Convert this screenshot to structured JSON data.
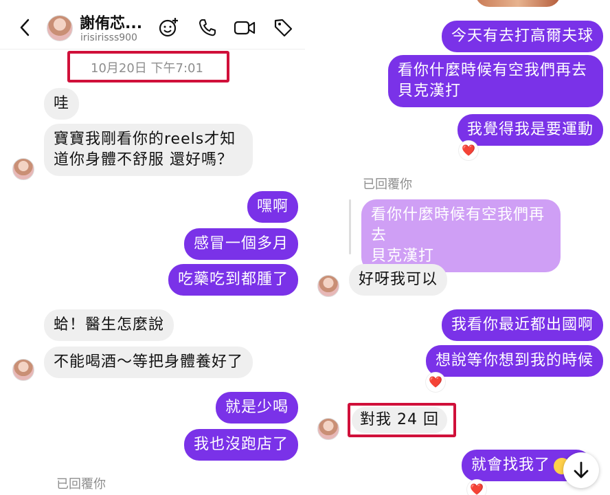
{
  "header": {
    "name": "謝侑芯...",
    "username": "irisirisss900"
  },
  "left": {
    "timestamp": "10月20日 下午7:01",
    "messages": [
      {
        "text": "哇"
      },
      {
        "text": "寶寶我剛看你的reels才知"
      },
      {
        "text": "道你身體不舒服 還好嗎？"
      },
      {
        "text": "嘿啊"
      },
      {
        "text": "感冒一個多月"
      },
      {
        "text": "吃藥吃到都腫了"
      },
      {
        "text": "蛤！醫生怎麼說"
      },
      {
        "text": "不能喝酒～等把身體養好了"
      },
      {
        "text": "就是少喝"
      },
      {
        "text": "我也沒跑店了"
      }
    ],
    "replied_label": "已回覆你"
  },
  "right": {
    "messages": [
      {
        "text": "今天有去打高爾夫球"
      },
      {
        "text": "看你什麼時候有空我們再去"
      },
      {
        "text": "貝克漢打"
      },
      {
        "text": "我覺得我是要運動"
      },
      {
        "text": "好呀我可以"
      },
      {
        "text": "我看你最近都出國啊"
      },
      {
        "text": "想說等你想到我的時候"
      },
      {
        "text": "對我 24 回"
      },
      {
        "text": "就會找我了"
      }
    ],
    "replied_label": "已回覆你",
    "quoted": {
      "line1": "看你什麼時候有空我們再去",
      "line2": "貝克漢打"
    },
    "reaction": "❤️"
  },
  "colors": {
    "outgoing": "#7a32e8",
    "incoming": "#efefef",
    "highlight": "#d0103a"
  }
}
